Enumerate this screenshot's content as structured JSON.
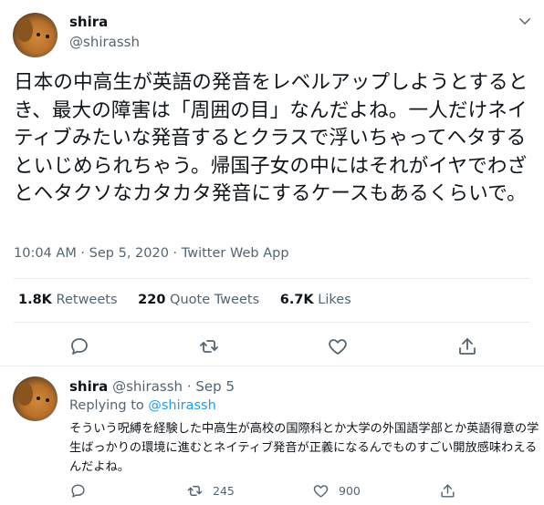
{
  "tweet": {
    "author_name": "shira",
    "author_handle": "@shirassh",
    "text": "日本の中高生が英語の発音をレベルアップしようとするとき、最大の障害は「周囲の目」なんだよね。一人だけネイティブみたいな発音するとクラスで浮いちゃってヘタするといじめられちゃう。帰国子女の中にはそれがイヤでわざとヘタクソなカタカタ発音にするケースもあるくらいで。",
    "meta": "10:04 AM · Sep 5, 2020 · Twitter Web App",
    "stats": {
      "retweets_num": "1.8K",
      "retweets_label": "Retweets",
      "quotes_num": "220",
      "quotes_label": "Quote Tweets",
      "likes_num": "6.7K",
      "likes_label": "Likes"
    },
    "icons": [
      "chevron-down-icon",
      "reply-icon",
      "retweet-icon",
      "like-icon",
      "share-icon"
    ]
  },
  "reply": {
    "author_name": "shira",
    "author_handle": "@shirassh",
    "separator": "·",
    "date": "Sep 5",
    "replying_prefix": "Replying to",
    "replying_to": "@shirassh",
    "text": "そういう呪縛を経験した中高生が高校の国際科とか大学の外国語学部とか英語得意の学生ばっかりの環境に進むとネイティブ発音が正義になるんでものすごい開放感味わえるんだよね。",
    "retweet_count": "245",
    "like_count": "900"
  },
  "colors": {
    "text": "#0f1419",
    "muted": "#536471",
    "link": "#1d9bf0",
    "border": "#e7ecf0"
  }
}
